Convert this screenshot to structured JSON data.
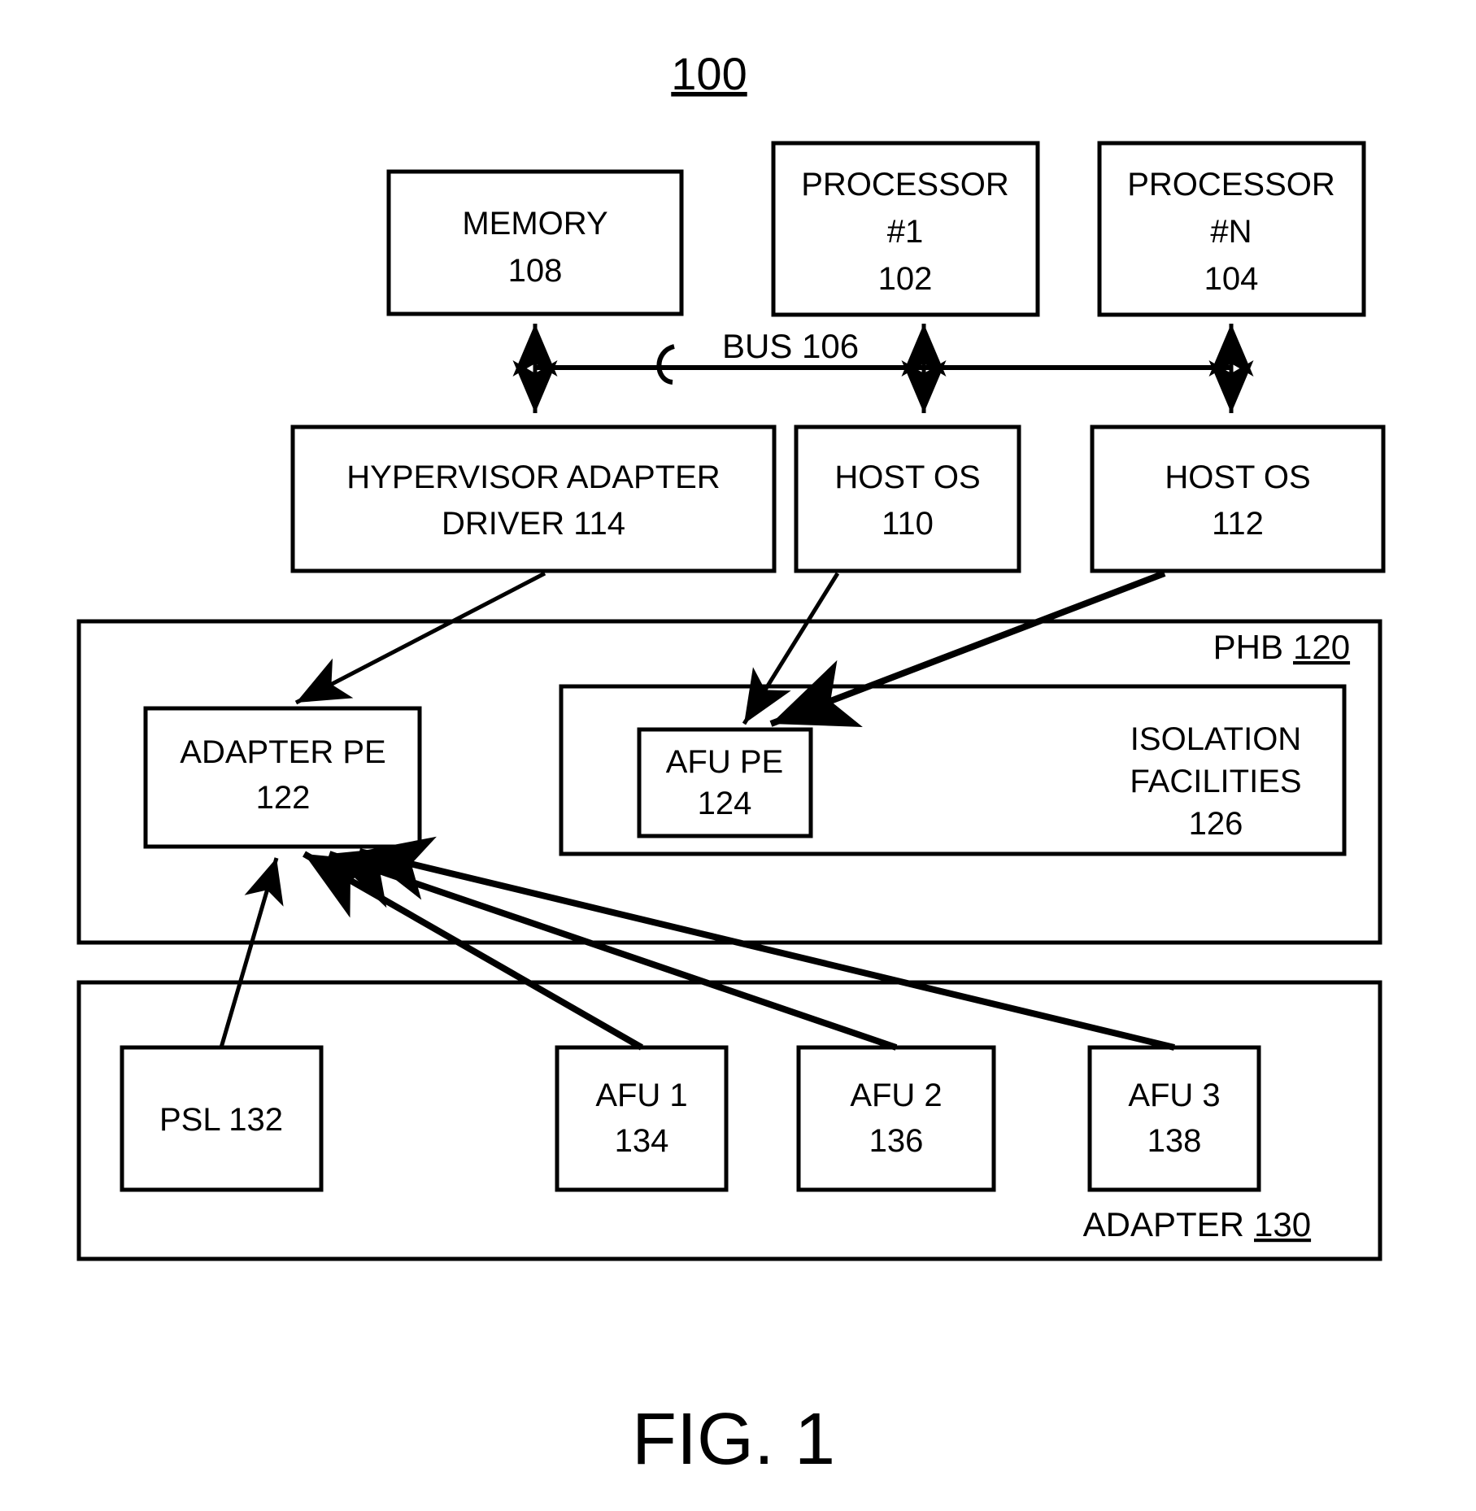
{
  "figure": {
    "ref_number": "100",
    "caption": "FIG. 1"
  },
  "nodes": {
    "memory": {
      "line1": "MEMORY",
      "line2": "108"
    },
    "processor1": {
      "line1": "PROCESSOR",
      "line2": "#1",
      "line3": "102"
    },
    "processorN": {
      "line1": "PROCESSOR",
      "line2": "#N",
      "line3": "104"
    },
    "bus": {
      "label": "BUS 106"
    },
    "hypervisor_adapter_driver": {
      "line1": "HYPERVISOR ADAPTER",
      "line2": "DRIVER 114"
    },
    "host_os_110": {
      "line1": "HOST OS",
      "line2": "110"
    },
    "host_os_112": {
      "line1": "HOST OS",
      "line2": "112"
    },
    "phb": {
      "label": "PHB",
      "number": "120"
    },
    "adapter_pe": {
      "line1": "ADAPTER PE",
      "line2": "122"
    },
    "afu_pe": {
      "line1": "AFU PE",
      "line2": "124"
    },
    "isolation_facilities": {
      "line1": "ISOLATION",
      "line2": "FACILITIES",
      "line3": "126"
    },
    "psl": {
      "line1": "PSL 132"
    },
    "afu1": {
      "line1": "AFU 1",
      "line2": "134"
    },
    "afu2": {
      "line1": "AFU 2",
      "line2": "136"
    },
    "afu3": {
      "line1": "AFU 3",
      "line2": "138"
    },
    "adapter": {
      "label": "ADAPTER",
      "number": "130"
    }
  },
  "colors": {
    "line": "#000000",
    "background": "#ffffff"
  }
}
